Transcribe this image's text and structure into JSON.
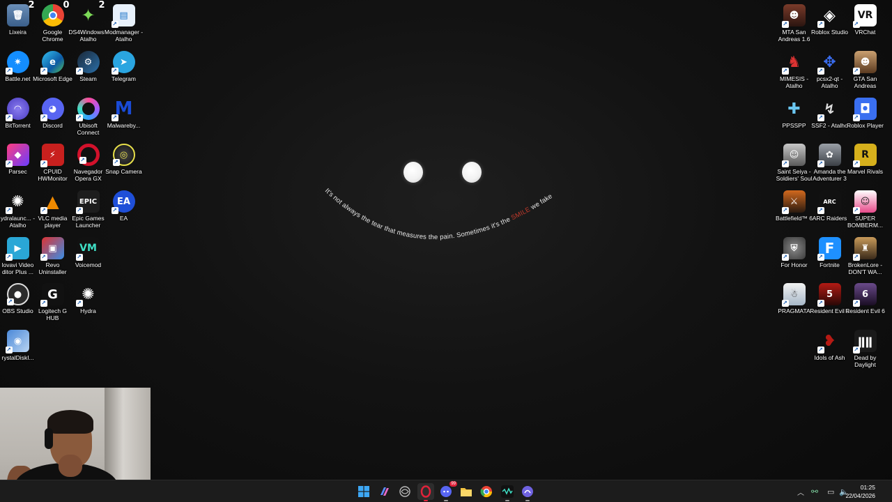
{
  "wallpaper": {
    "quote_part1": "It's not always the tear that measures the pain. Sometimes it's the ",
    "quote_highlight": "SMILE",
    "quote_part2": " we fake",
    "highlight_color": "#c0392b"
  },
  "desktop_icons": {
    "recycle_bin": {
      "label": "Lixeira",
      "badge": "2"
    },
    "chrome": {
      "label": "Google Chrome",
      "badge": "0"
    },
    "ds4windows": {
      "label": "DS4Windows - Atalho",
      "badge": "2"
    },
    "modmanager": {
      "label": "Modmanager - Atalho"
    },
    "battlenet": {
      "label": "Battle.net"
    },
    "edge": {
      "label": "Microsoft Edge"
    },
    "steam": {
      "label": "Steam"
    },
    "telegram": {
      "label": "Telegram"
    },
    "bittorrent": {
      "label": "BitTorrent"
    },
    "discord": {
      "label": "Discord"
    },
    "ubisoft": {
      "label": "Ubisoft Connect"
    },
    "malwarebytes": {
      "label": "Malwareby..."
    },
    "parsec": {
      "label": "Parsec"
    },
    "cpuid": {
      "label": "CPUID HWMonitor"
    },
    "opera": {
      "label": "Navegador Opera GX"
    },
    "snapcamera": {
      "label": "Snap Camera"
    },
    "hydralauncher": {
      "label": "ydralaunc... - Atalho"
    },
    "vlc": {
      "label": "VLC media player"
    },
    "epic": {
      "label": "Epic Games Launcher",
      "glyph": "EPIC"
    },
    "ea": {
      "label": "EA",
      "glyph": "EA"
    },
    "movavi": {
      "label": "lovavi Video ditor Plus ..."
    },
    "revo": {
      "label": "Revo Uninstaller"
    },
    "voicemod": {
      "label": "Voicemod"
    },
    "obs": {
      "label": "OBS Studio"
    },
    "logitech": {
      "label": "Logitech G HUB"
    },
    "hydra": {
      "label": "Hydra"
    },
    "crystaldisk": {
      "label": "rystalDiskI..."
    },
    "mta": {
      "label": "MTA San Andreas 1.6"
    },
    "roblox_studio": {
      "label": "Roblox Studio"
    },
    "vrchat": {
      "label": "VRChat",
      "glyph": "VR"
    },
    "mimesis": {
      "label": "MIMESIS - Atalho"
    },
    "pcsx2": {
      "label": "pcsx2-qt - Atalho"
    },
    "gta_sa": {
      "label": "GTA San Andreas"
    },
    "ppsspp": {
      "label": "PPSSPP"
    },
    "ssf2": {
      "label": "SSF2 - Atalho"
    },
    "roblox_player": {
      "label": "Roblox Player"
    },
    "saint_seiya": {
      "label": "Saint Seiya - Soldiers' Soul"
    },
    "amanda": {
      "label": "Amanda the Adventurer 3"
    },
    "marvel_rivals": {
      "label": "Marvel Rivals"
    },
    "battlefield": {
      "label": "Battlefield™ 6"
    },
    "arc_raiders": {
      "label": "ARC Raiders"
    },
    "bomberman": {
      "label": "SUPER BOMBERM..."
    },
    "for_honor": {
      "label": "For Honor"
    },
    "fortnite": {
      "label": "Fortnite"
    },
    "brokenlore": {
      "label": "BrokenLore - DON'T WA..."
    },
    "pragmata": {
      "label": "PRAGMATA"
    },
    "re5": {
      "label": "Resident Evil 5"
    },
    "re6": {
      "label": "Resident Evil 6"
    },
    "idols_of_ash": {
      "label": "Idols of Ash"
    },
    "dbd": {
      "label": "Dead by Daylight"
    }
  },
  "taskbar": {
    "discord_badge": "99",
    "icons": [
      "start-icon",
      "copilot-icon",
      "nvidia-icon",
      "opera-gx-icon",
      "discord-icon",
      "file-explorer-icon",
      "chrome-icon",
      "voicemod-icon",
      "bittorrent-icon"
    ]
  },
  "tray": {
    "time": "01:25",
    "date": "22/04/2026"
  },
  "colors": {
    "taskbar_bg": "#1c1c1c",
    "desktop_bg": "#121212"
  }
}
